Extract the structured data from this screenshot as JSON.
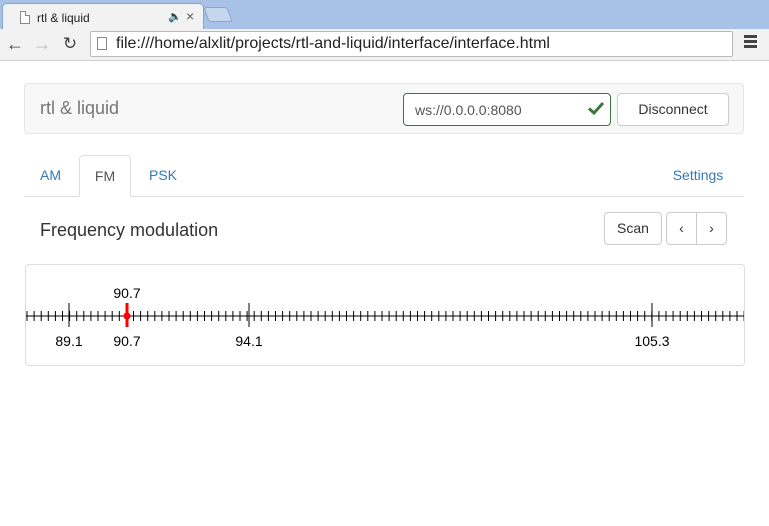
{
  "browser": {
    "tab_title": "rtl & liquid",
    "url": "file:///home/alxlit/projects/rtl-and-liquid/interface/interface.html"
  },
  "navbar": {
    "brand": "rtl & liquid",
    "ws_value": "ws://0.0.0.0:8080",
    "disconnect_label": "Disconnect"
  },
  "tabs": {
    "am": "AM",
    "fm": "FM",
    "psk": "PSK",
    "settings": "Settings"
  },
  "panel": {
    "title": "Frequency modulation",
    "scan_label": "Scan",
    "prev_label": "‹",
    "next_label": "›"
  },
  "scale": {
    "selected": "90.7",
    "marker_color": "#ff0000",
    "labels": [
      "89.1",
      "90.7",
      "94.1",
      "105.3"
    ]
  }
}
